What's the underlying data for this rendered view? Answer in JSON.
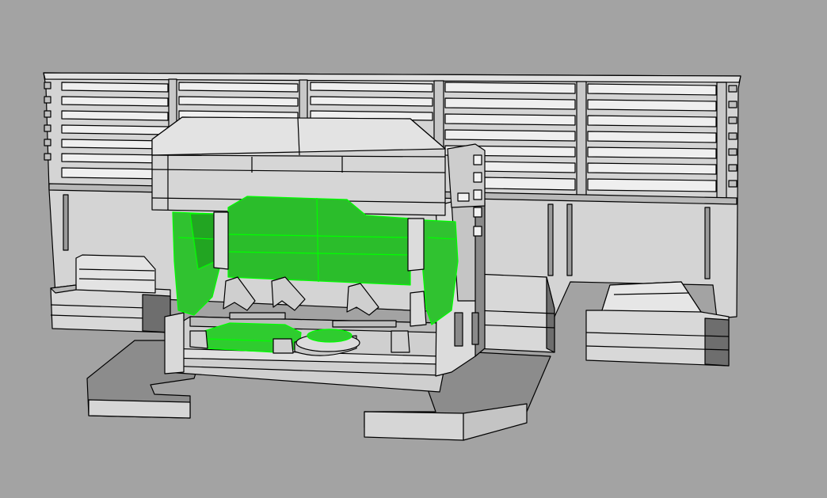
{
  "viewport": {
    "background": "#a3a3a3"
  },
  "model": {
    "surface_color": "#d9d9d9",
    "surface_light": "#e6e6e6",
    "surface_shade": "#bdbdbd",
    "surface_dark": "#6e6e6e",
    "edge_color": "#000000",
    "selection_color": "#2fd12f",
    "selection_edge": "#00ff00",
    "floor_color": "#8c8c8c"
  }
}
